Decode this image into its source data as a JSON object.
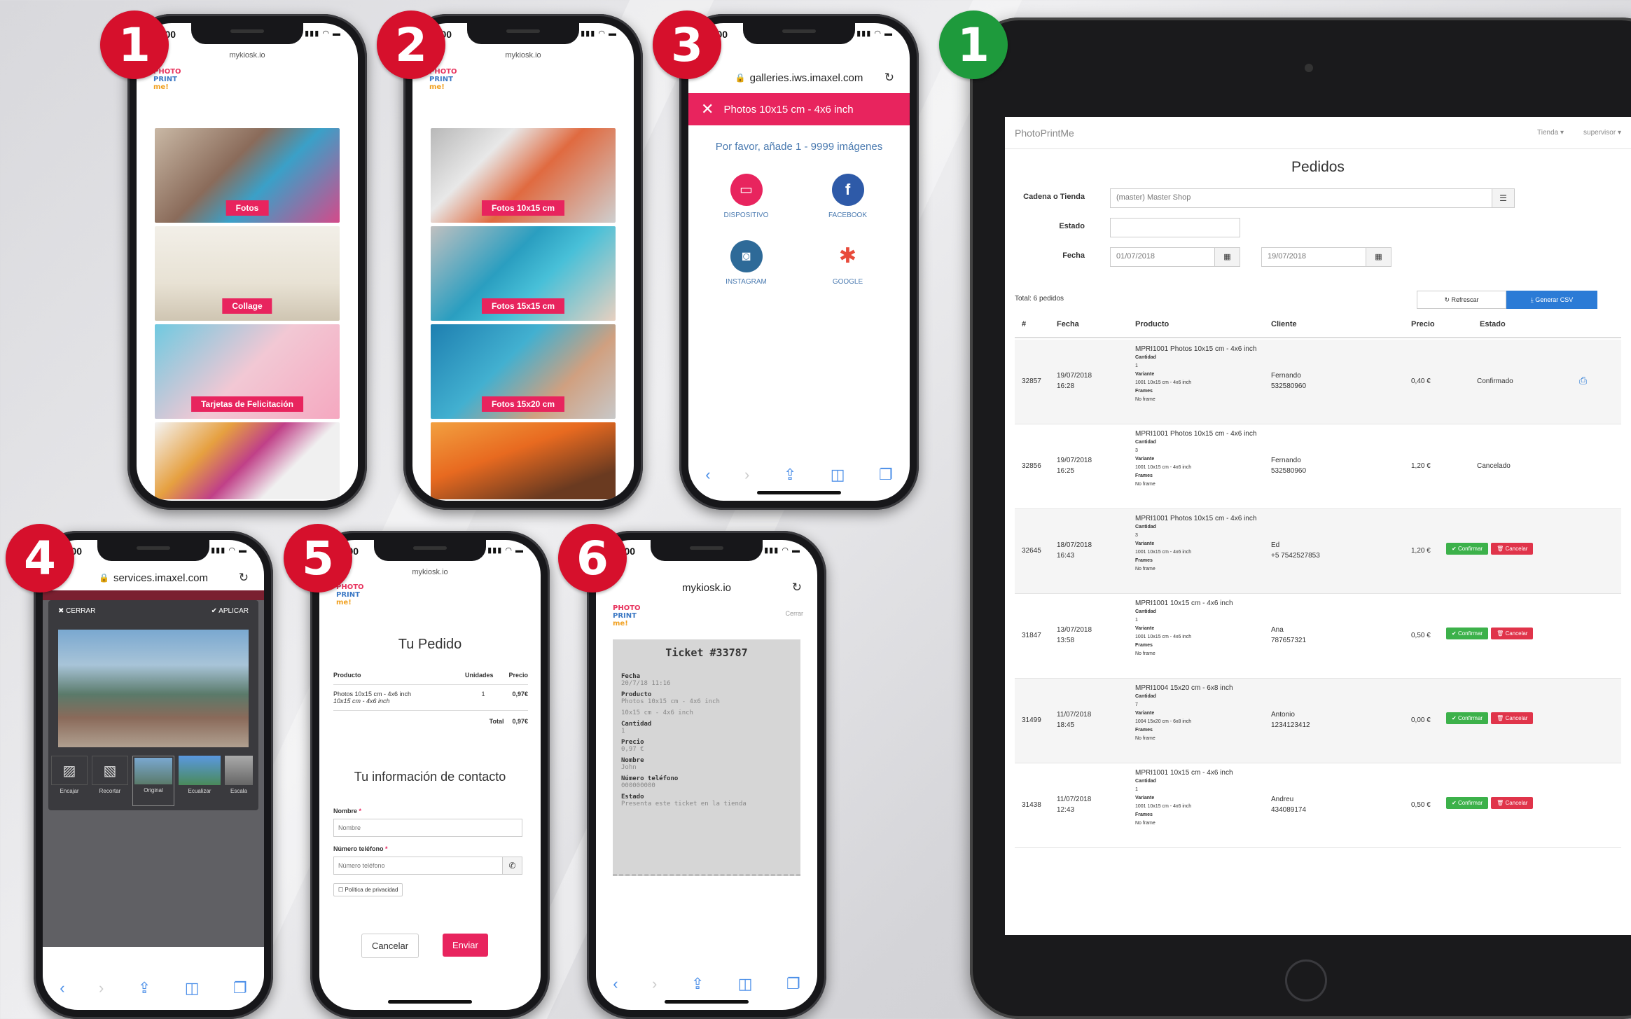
{
  "badges": {
    "p1": "1",
    "p2": "2",
    "p3": "3",
    "p4": "4",
    "p5": "5",
    "p6": "6",
    "tablet": "1"
  },
  "phone1": {
    "time": "9:00",
    "url": "mykiosk.io",
    "logo": [
      "PHOTO",
      "PRINT",
      "me!"
    ],
    "tiles": [
      "Fotos",
      "Collage",
      "Tarjetas de Felicitación"
    ]
  },
  "phone2": {
    "time": "9:00",
    "url": "mykiosk.io",
    "logo": [
      "PHOTO",
      "PRINT",
      "me!"
    ],
    "tiles": [
      "Fotos 10x15 cm",
      "Fotos 15x15 cm",
      "Fotos 15x20 cm"
    ]
  },
  "phone3": {
    "time": "9:00",
    "url": "galleries.iws.imaxel.com",
    "header": "Photos 10x15 cm - 4x6 inch",
    "prompt": "Por favor, añade 1 - 9999 imágenes",
    "sources": [
      "DISPOSITIVO",
      "FACEBOOK",
      "INSTAGRAM",
      "GOOGLE"
    ]
  },
  "phone4": {
    "time": "9:00",
    "url": "services.imaxel.com",
    "cancel": "CERRAR",
    "apply": "APLICAR",
    "tools": [
      "Encajar",
      "Recortar",
      "Original",
      "Ecualizar",
      "Escala"
    ]
  },
  "phone5": {
    "time": "9:00",
    "url": "mykiosk.io",
    "title": "Tu Pedido",
    "headers": [
      "Producto",
      "Unidades",
      "Precio"
    ],
    "item": "Photos 10x15 cm - 4x6 inch",
    "item_sub": "10x15 cm - 4x6 inch",
    "qty": "1",
    "price": "0,97€",
    "total_label": "Total",
    "total": "0,97€",
    "contact_title": "Tu información de contacto",
    "name_label": "Nombre",
    "name_ph": "Nombre",
    "phone_label": "Número teléfono",
    "phone_ph": "Número teléfono",
    "privacy": "Política de privacidad",
    "cancel": "Cancelar",
    "send": "Enviar"
  },
  "phone6": {
    "time": "9:00",
    "url": "mykiosk.io",
    "close": "Cerrar",
    "ticket_title": "Ticket #33787",
    "fields": [
      {
        "k": "Fecha",
        "v": "20/7/18 11:16"
      },
      {
        "k": "Producto",
        "v": "Photos 10x15 cm - 4x6 inch"
      },
      {
        "k": "",
        "v": "10x15 cm - 4x6 inch"
      },
      {
        "k": "Cantidad",
        "v": "1"
      },
      {
        "k": "Precio",
        "v": "0,97 €"
      },
      {
        "k": "Nombre",
        "v": "John"
      },
      {
        "k": "Número teléfono",
        "v": "000000000"
      },
      {
        "k": "Estado",
        "v": "Presenta este ticket en la tienda"
      }
    ]
  },
  "tablet": {
    "brand": "PhotoPrintMe",
    "nav_store": "Tienda",
    "nav_user": "supervisor",
    "title": "Pedidos",
    "filter_store_label": "Cadena o Tienda",
    "filter_store_value": "(master) Master Shop",
    "filter_status_label": "Estado",
    "filter_date_label": "Fecha",
    "date_from": "01/07/2018",
    "date_to": "19/07/2018",
    "total": "Total: 6 pedidos",
    "refresh": "Refrescar",
    "csv": "Generar CSV",
    "cols": [
      "#",
      "Fecha",
      "Producto",
      "Cliente",
      "Precio",
      "Estado"
    ],
    "confirm": "Confirmar",
    "cancel": "Cancelar",
    "rows": [
      {
        "id": "32857",
        "date": "19/07/2018",
        "time": "16:28",
        "product": "MPRI1001 Photos 10x15 cm - 4x6 inch",
        "qty": "1",
        "variant": "1001 10x15 cm - 4x6 inch",
        "frames": "No frame",
        "client": "Fernando",
        "phone": "532580960",
        "price": "0,40 €",
        "status": "Confirmado",
        "printable": true
      },
      {
        "id": "32856",
        "date": "19/07/2018",
        "time": "16:25",
        "product": "MPRI1001 Photos 10x15 cm - 4x6 inch",
        "qty": "3",
        "variant": "1001 10x15 cm - 4x6 inch",
        "frames": "No frame",
        "client": "Fernando",
        "phone": "532580960",
        "price": "1,20 €",
        "status": "Cancelado",
        "printable": false
      },
      {
        "id": "32645",
        "date": "18/07/2018",
        "time": "16:43",
        "product": "MPRI1001 Photos 10x15 cm - 4x6 inch",
        "qty": "3",
        "variant": "1001 10x15 cm - 4x6 inch",
        "frames": "No frame",
        "client": "Ed",
        "phone": "+5 7542527853",
        "price": "1,20 €",
        "status": "",
        "printable": false
      },
      {
        "id": "31847",
        "date": "13/07/2018",
        "time": "13:58",
        "product": "MPRI1001 10x15 cm - 4x6 inch",
        "qty": "1",
        "variant": "1001 10x15 cm - 4x6 inch",
        "frames": "No frame",
        "client": "Ana",
        "phone": "787657321",
        "price": "0,50 €",
        "status": "",
        "printable": false
      },
      {
        "id": "31499",
        "date": "11/07/2018",
        "time": "18:45",
        "product": "MPRI1004 15x20 cm - 6x8 inch",
        "qty": "7",
        "variant": "1004 15x20 cm - 6x8 inch",
        "frames": "No frame",
        "client": "Antonio",
        "phone": "1234123412",
        "price": "0,00 €",
        "status": "",
        "printable": false
      },
      {
        "id": "31438",
        "date": "11/07/2018",
        "time": "12:43",
        "product": "MPRI1001 10x15 cm - 4x6 inch",
        "qty": "1",
        "variant": "1001 10x15 cm - 4x6 inch",
        "frames": "No frame",
        "client": "Andreu",
        "phone": "434089174",
        "price": "0,50 €",
        "status": "",
        "printable": false
      }
    ],
    "sub_qty": "Cantidad",
    "sub_variant": "Variante",
    "sub_frames": "Frames"
  },
  "colors": {
    "accent": "#e8245e",
    "badge_red": "#d6102c",
    "badge_green": "#1e9a3c",
    "confirm": "#3cb14a",
    "cancel": "#e0344a",
    "csv": "#2b7bd6"
  }
}
